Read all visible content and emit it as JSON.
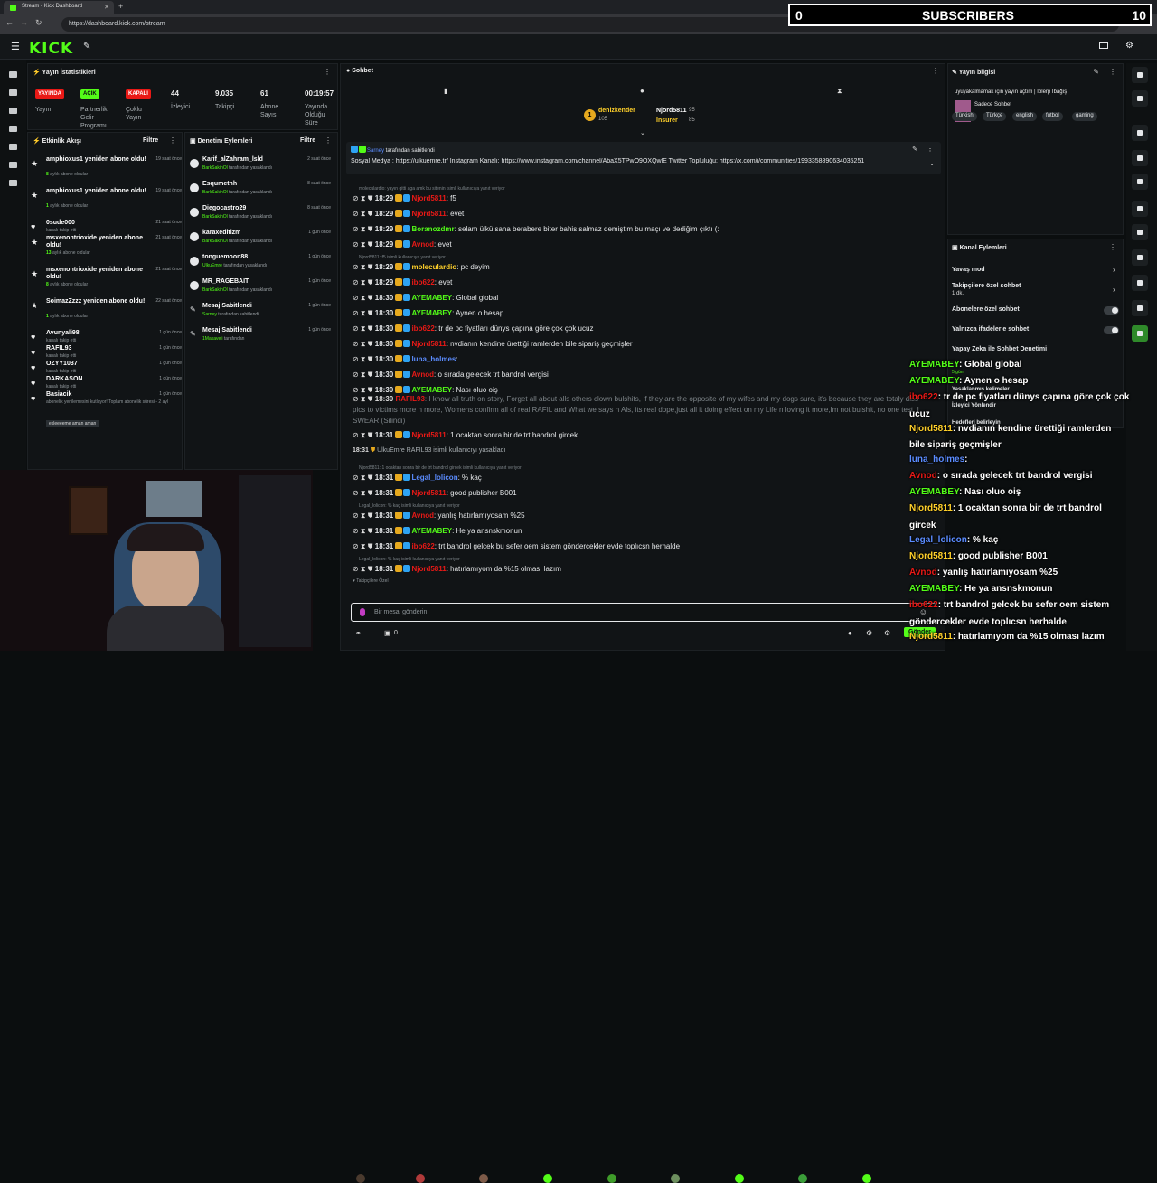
{
  "browser": {
    "tab_title": "Stream - Kick Dashboard",
    "url": "https://dashboard.kick.com/stream"
  },
  "overlay": {
    "sub_count": "0",
    "sub_label": "SUBSCRIBERS",
    "sub_right": "10"
  },
  "brand": "KICK",
  "stats": {
    "title": "Yayın İstatistikleri",
    "badges": [
      "YAYINDA",
      "AÇIK",
      "KAPALI"
    ],
    "labels": [
      "Yayın",
      "Partnerlik Gelir Programı",
      "Çoklu Yayın"
    ],
    "viewers": "44",
    "viewers_label": "İzleyici",
    "followers": "9.035",
    "followers_label": "Takipçi",
    "subs": "61",
    "subs_label": "Abone Sayısı",
    "uptime": "00:19:57",
    "uptime_label": "Yayında Olduğu Süre"
  },
  "activity": {
    "title": "Etkinlik Akışı",
    "filter": "Filtre",
    "items": [
      {
        "t": "amphioxus1 yeniden abone oldu!",
        "s": "8",
        "s2": " aylık abone oldular",
        "tm": "19 saat önce"
      },
      {
        "t": "amphioxus1 yeniden abone oldu!",
        "s": "1",
        "s2": " aylık abone oldular",
        "tm": "19 saat önce"
      },
      {
        "t": "0sude000",
        "s": "",
        "s2": "kanalı takip etti",
        "tm": "21 saat önce"
      },
      {
        "t": "msxenontrioxide yeniden abone oldu!",
        "s": "13",
        "s2": " aylık abone oldular",
        "tm": "21 saat önce"
      },
      {
        "t": "msxenontrioxide yeniden abone oldu!",
        "s": "8",
        "s2": " aylık abone oldular",
        "tm": "21 saat önce"
      },
      {
        "t": "SoimazZzzz yeniden abone oldu!",
        "s": "1",
        "s2": " aylık abone oldular",
        "tm": "22 saat önce"
      },
      {
        "t": "Avunyali98",
        "s": "",
        "s2": "kanalı takip etti",
        "tm": "1 gün önce"
      },
      {
        "t": "RAFIL93",
        "s": "",
        "s2": "kanalı takip etti",
        "tm": "1 gün önce"
      },
      {
        "t": "OZYY1037",
        "s": "",
        "s2": "kanalı takip etti",
        "tm": "1 gün önce"
      },
      {
        "t": "DARKASON",
        "s": "",
        "s2": "kanalı takip etti",
        "tm": "1 gün önce"
      },
      {
        "t": "Basiacik",
        "s": "",
        "s2": "abonelik yenilemesini kutluyor! Toplam abonelik süresi - 2 ayl",
        "tm": "1 gün önce"
      }
    ],
    "last_note": "ekleeeeme aman aman"
  },
  "moderation": {
    "title": "Denetim Eylemleri",
    "filter": "Filtre",
    "items": [
      {
        "t": "Karif_alZahram_lsld",
        "by": "BarkSakinOl",
        "s": " tarafından yasaklandı",
        "tm": "2 saat önce"
      },
      {
        "t": "Esqumethh",
        "by": "BarkSakinOl",
        "s": " tarafından yasaklandı",
        "tm": "8 saat önce"
      },
      {
        "t": "Diegocastro29",
        "by": "BarkSakinOl",
        "s": " tarafından yasaklandı",
        "tm": "8 saat önce"
      },
      {
        "t": "karaxeditizm",
        "by": "BarkSakinOl",
        "s": " tarafından yasaklandı",
        "tm": "1 gün önce"
      },
      {
        "t": "tonguemoon88",
        "by": "UlkuEmre",
        "s": " tarafından yasaklandı",
        "tm": "1 gün önce"
      },
      {
        "t": "MR_RAGEBAIT",
        "by": "BarkSakinOl",
        "s": " tarafından yasaklandı",
        "tm": "1 gün önce"
      },
      {
        "t": "Mesaj Sabitlendi",
        "by": "Sarney",
        "s": " tarafından sabitlendi",
        "tm": "1 gün önce"
      },
      {
        "t": "Mesaj Sabitlendi",
        "by": "1Makaveli",
        "s": " tarafından",
        "tm": "1 gün önce"
      }
    ]
  },
  "chat": {
    "title": "Sohbet",
    "leaders": [
      {
        "name": "denizkender",
        "pts": "105"
      },
      {
        "name": "Njord5811",
        "pts": "95"
      },
      {
        "name": "Insurer",
        "pts": "85"
      }
    ],
    "pinned_by": "Sarney",
    "pinned_suffix": " tarafından sabitlendi",
    "pinned_text": "Sosyal Medya : ",
    "pinned_link1": "https://ulkuemre.tr/",
    "pinned_text2": " Instagram Kanalı: ",
    "pinned_link2": "https://www.instagram.com/channel/AbaX5TPwO9OXQwlE",
    "pinned_text3": " Twitter Topluluğu: ",
    "pinned_link3": "https://x.com/i/communities/1993358890634035251",
    "rows": [
      {
        "reply": "moleculardio: yayın gitti aga amk bu sitenin isimli kullanıcıya yanıt veriyor"
      },
      {
        "ts": "18:29",
        "u": "Njord5811",
        "uc": "#e91916",
        "m": ": f5"
      },
      {
        "ts": "18:29",
        "u": "Njord5811",
        "uc": "#e91916",
        "m": ": evet"
      },
      {
        "ts": "18:29",
        "u": "Boranozdmr",
        "uc": "#53fc18",
        "m": ": selam ülkü sana berabere biter bahis salmaz demiştim bu maçı ve dediğim çıktı (:"
      },
      {
        "ts": "18:29",
        "u": "Avnod",
        "uc": "#e91916",
        "m": ": evet"
      },
      {
        "reply": "Njord5811: f5 isimli kullanıcıya yanıt veriyor"
      },
      {
        "ts": "18:29",
        "u": "moleculardio",
        "uc": "#ffd02a",
        "m": ": pc deyim"
      },
      {
        "ts": "18:29",
        "u": "ibo622",
        "uc": "#e91916",
        "m": ": evet"
      },
      {
        "ts": "18:30",
        "u": "AYEMABEY",
        "uc": "#53fc18",
        "m": ": Global global"
      },
      {
        "ts": "18:30",
        "u": "AYEMABEY",
        "uc": "#53fc18",
        "m": ": Aynen o hesap"
      },
      {
        "ts": "18:30",
        "u": "ibo622",
        "uc": "#e91916",
        "m": ": tr de pc fiyatları dünys çapına göre çok çok ucuz"
      },
      {
        "ts": "18:30",
        "u": "Njord5811",
        "uc": "#e91916",
        "m": ": nvdianın kendine ürettiği ramlerden bile sipariş geçmişler"
      },
      {
        "ts": "18:30",
        "u": "luna_holmes",
        "uc": "#5b8cff",
        "m": ":"
      },
      {
        "ts": "18:30",
        "u": "Avnod",
        "uc": "#e91916",
        "m": ": o sırada gelecek trt bandrol vergisi"
      },
      {
        "ts": "18:30",
        "u": "AYEMABEY",
        "uc": "#53fc18",
        "m": ": Nası oluo oiş"
      }
    ],
    "long_ts": "18:30",
    "long_user": "RAFIL93",
    "long_text": ": I know all truth on story, Forget all about alls others clown bulshits, If they are the opposite of my wifes and my dogs sure, it's because they are totaly diss pics to victims more n more, Womens confirm all of real RAFIL and What we says n Als, its real dope,just all it doing effect on my Life n loving it more,Im not bulshit, no one test, I SWEAR (Silindi)",
    "rows2": [
      {
        "ts": "18:31",
        "u": "Njord5811",
        "uc": "#e91916",
        "m": ": 1 ocaktan sonra bir de trt bandrol gircek"
      }
    ],
    "ban_ts": "18:31",
    "ban_by": "UlkuEmre",
    "ban_text": " RAFIL93 isimli kullanıcıyı yasakladı",
    "rows3": [
      {
        "reply": "Njord5811: 1 ocaktan sonra bir de trt bandrol gircek isimli kullanıcıya yanıt veriyor"
      },
      {
        "ts": "18:31",
        "u": "Legal_lolicon",
        "uc": "#5b8cff",
        "m": ": % kaç"
      },
      {
        "ts": "18:31",
        "u": "Njord5811",
        "uc": "#e91916",
        "m": ": good publisher B001"
      },
      {
        "reply": "Legal_lolicon: % kaç isimli kullanıcıya yanıt veriyor"
      },
      {
        "ts": "18:31",
        "u": "Avnod",
        "uc": "#e91916",
        "m": ": yanlış hatırlamıyosam %25"
      },
      {
        "ts": "18:31",
        "u": "AYEMABEY",
        "uc": "#53fc18",
        "m": ": He ya ansnskmonun"
      },
      {
        "ts": "18:31",
        "u": "ibo622",
        "uc": "#e91916",
        "m": ": trt bandrol gelcek bu sefer oem sistem göndercekler evde toplıcsn herhalde"
      },
      {
        "reply": "Legal_lolicon: % kaç isimli kullanıcıya yanıt veriyor"
      },
      {
        "ts": "18:31",
        "u": "Njord5811",
        "uc": "#e91916",
        "m": ": hatırlamıyom da %15 olması lazım"
      }
    ],
    "emotes_label": "Takipçilere Özel",
    "input_placeholder": "Bir mesaj gönderin",
    "counter": "0",
    "send_label": "Gönder"
  },
  "stream_info": {
    "title": "Yayın bilgisi",
    "stream_title": "uyuyakalmamak için yayın açtım | Iblerp Ibağış",
    "category": "Sadece Sohbet",
    "tags": [
      "Türkish",
      "Türkçe",
      "english",
      "futbol",
      "gaming"
    ]
  },
  "channel_actions": {
    "title": "Kanal Eylemleri",
    "items": [
      "Yavaş mod",
      "Takipçilere özel sohbet",
      "Abonelere özel sohbet",
      "Yalnızca ifadelerle sohbet",
      "Yapay Zeka ile Sohbet Denetimi",
      "Yasaklanmış kelimeler",
      "İzleyici Yönlendir",
      "Hedefleri belirleyin"
    ],
    "follow_sub": "1 dk.",
    "ai_sub": "5 gün"
  },
  "overlay_chat": [
    {
      "u": "AYEMABEY",
      "uc": "#53fc18",
      "m": ": Global global"
    },
    {
      "u": "AYEMABEY",
      "uc": "#53fc18",
      "m": ": Aynen o hesap"
    },
    {
      "u": "ibo622",
      "uc": "#e91916",
      "m": ": tr de pc fiyatları dünys çapına göre çok çok"
    },
    {
      "u": "",
      "uc": "",
      "m": "ucuz"
    },
    {
      "u": "Njord5811",
      "uc": "#ffd02a",
      "m": ": nvdianın kendine ürettiği ramlerden"
    },
    {
      "u": "",
      "uc": "",
      "m": "bile sipariş geçmişler"
    },
    {
      "u": "luna_holmes",
      "uc": "#5b8cff",
      "m": ":"
    },
    {
      "u": "Avnod",
      "uc": "#e91916",
      "m": ": o sırada gelecek trt bandrol vergisi"
    },
    {
      "u": "AYEMABEY",
      "uc": "#53fc18",
      "m": ": Nası oluo oiş"
    },
    {
      "u": "Njord5811",
      "uc": "#ffd02a",
      "m": ": 1 ocaktan sonra bir de trt bandrol"
    },
    {
      "u": "",
      "uc": "",
      "m": "gircek"
    },
    {
      "u": "Legal_lolicon",
      "uc": "#5b8cff",
      "m": ": % kaç"
    },
    {
      "u": "Njord5811",
      "uc": "#ffd02a",
      "m": ": good publisher B001"
    },
    {
      "u": "Avnod",
      "uc": "#e91916",
      "m": ": yanlış hatırlamıyosam %25"
    },
    {
      "u": "AYEMABEY",
      "uc": "#53fc18",
      "m": ": He ya ansnskmonun"
    },
    {
      "u": "ibo622",
      "uc": "#e91916",
      "m": ": trt bandrol gelcek bu sefer oem sistem"
    },
    {
      "u": "",
      "uc": "",
      "m": "göndercekler evde toplıcsn herhalde"
    },
    {
      "u": "Njord5811",
      "uc": "#ffd02a",
      "m": ": hatırlamıyom da %15 olması lazım"
    }
  ],
  "colors": {
    "accent": "#53fc18",
    "live": "#e91916",
    "bg": "#0b0e0f",
    "panel": "#111416"
  }
}
